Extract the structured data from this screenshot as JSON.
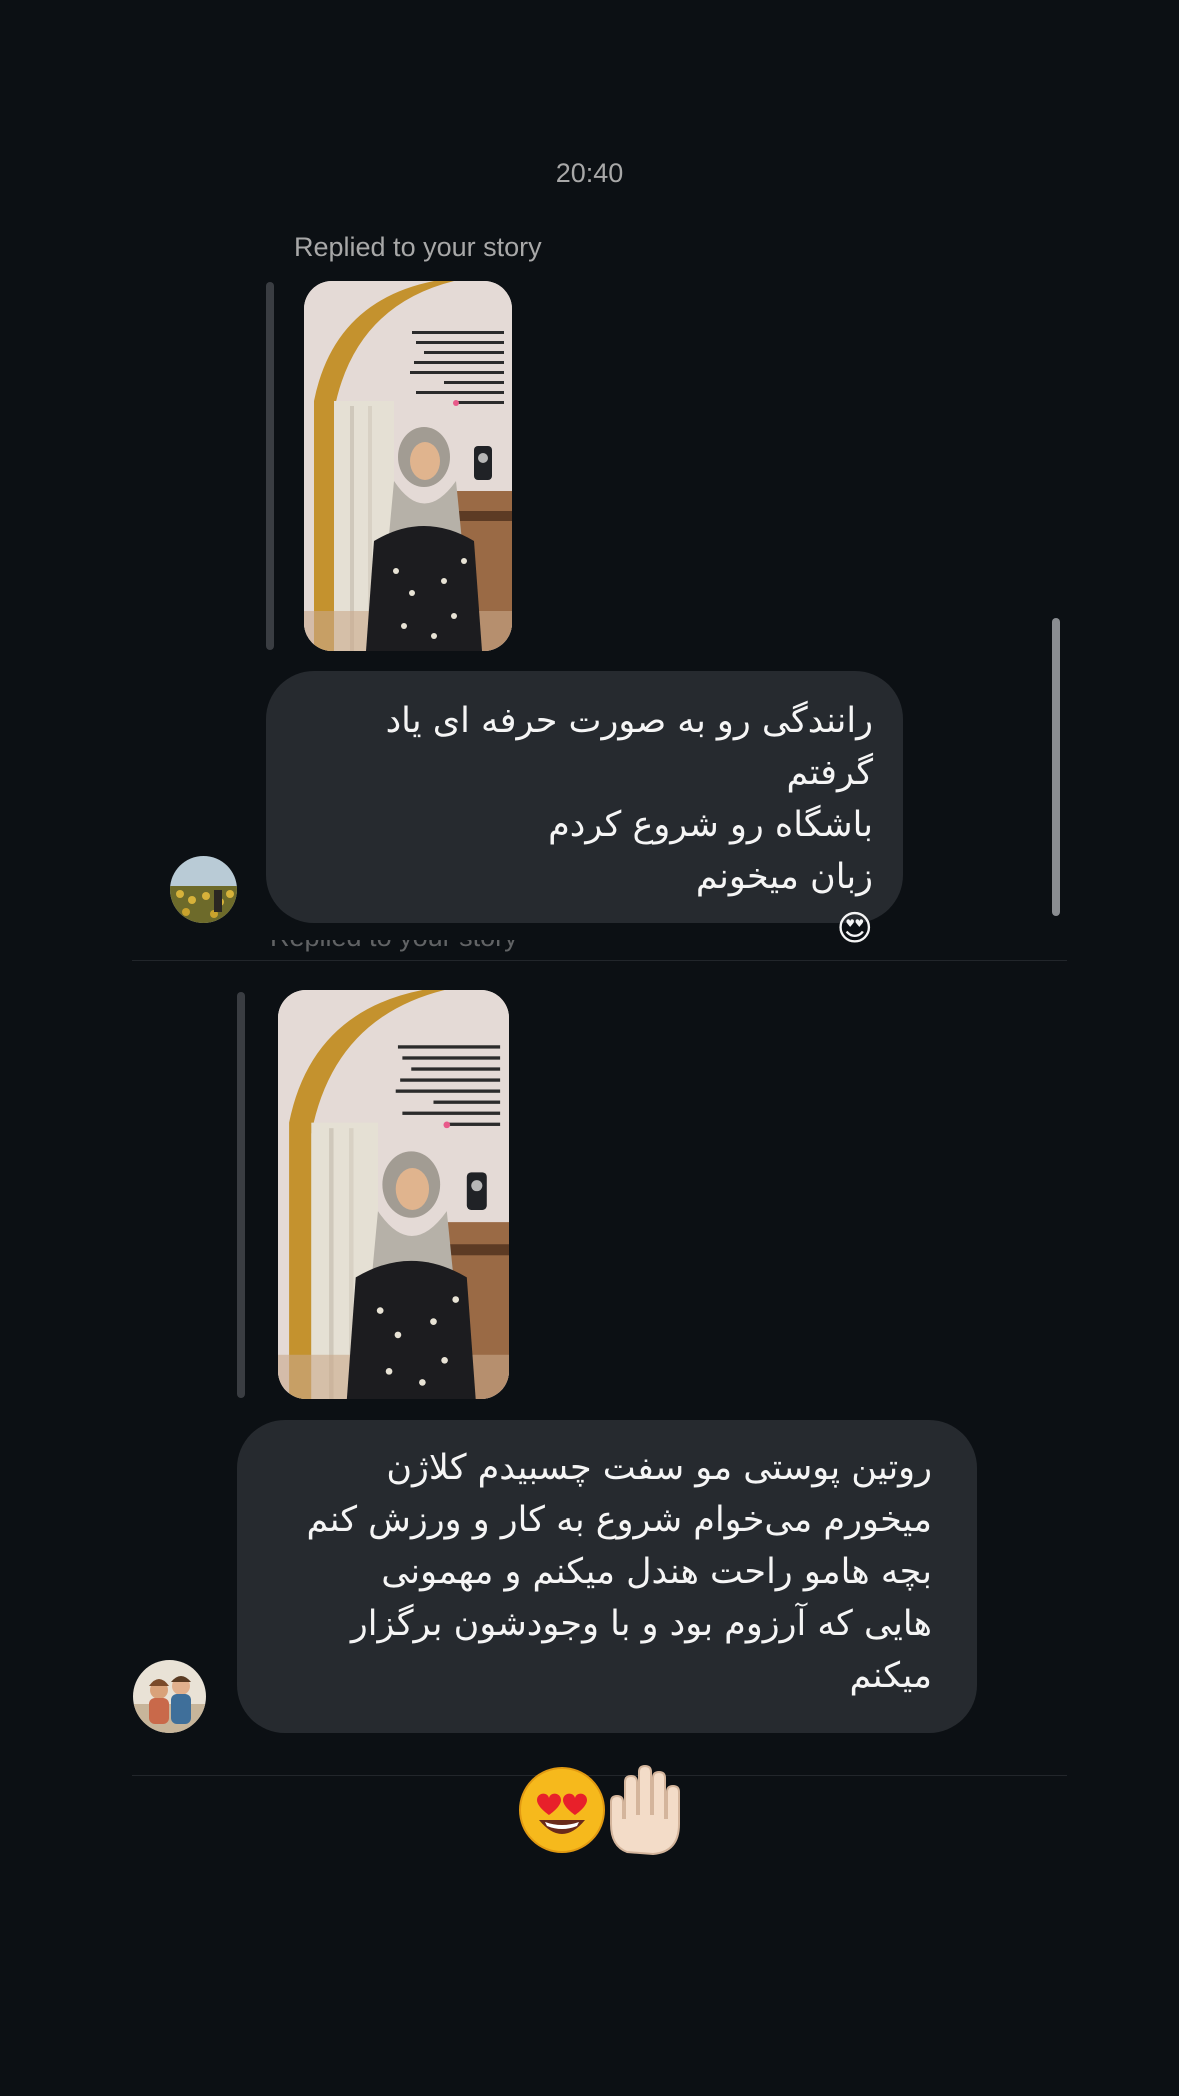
{
  "timestamp": "20:40",
  "messages": [
    {
      "reply_label": "Replied to your story",
      "text": "رانندگی رو به صورت حرفه ای یاد گرفتم\nباشگاه رو شروع کردم\nزبان میخونم\n😍"
    },
    {
      "reply_label": "Replied to your story",
      "text": "روتین پوستی مو سفت چسبیدم کلاژن\nمیخورم می‌خوام شروع به کار و ورزش کنم\nبچه هامو راحت هندل میکنم و مهمونی\nهایی که آرزوم بود و با وجودشون برگزار\nمیکنم"
    }
  ],
  "quick_reactions": [
    "😍",
    "✋🏻"
  ],
  "colors": {
    "background": "#0c1014",
    "bubble": "#262a2f",
    "muted_text": "#a8a8a8",
    "text": "#f5f5f5"
  }
}
